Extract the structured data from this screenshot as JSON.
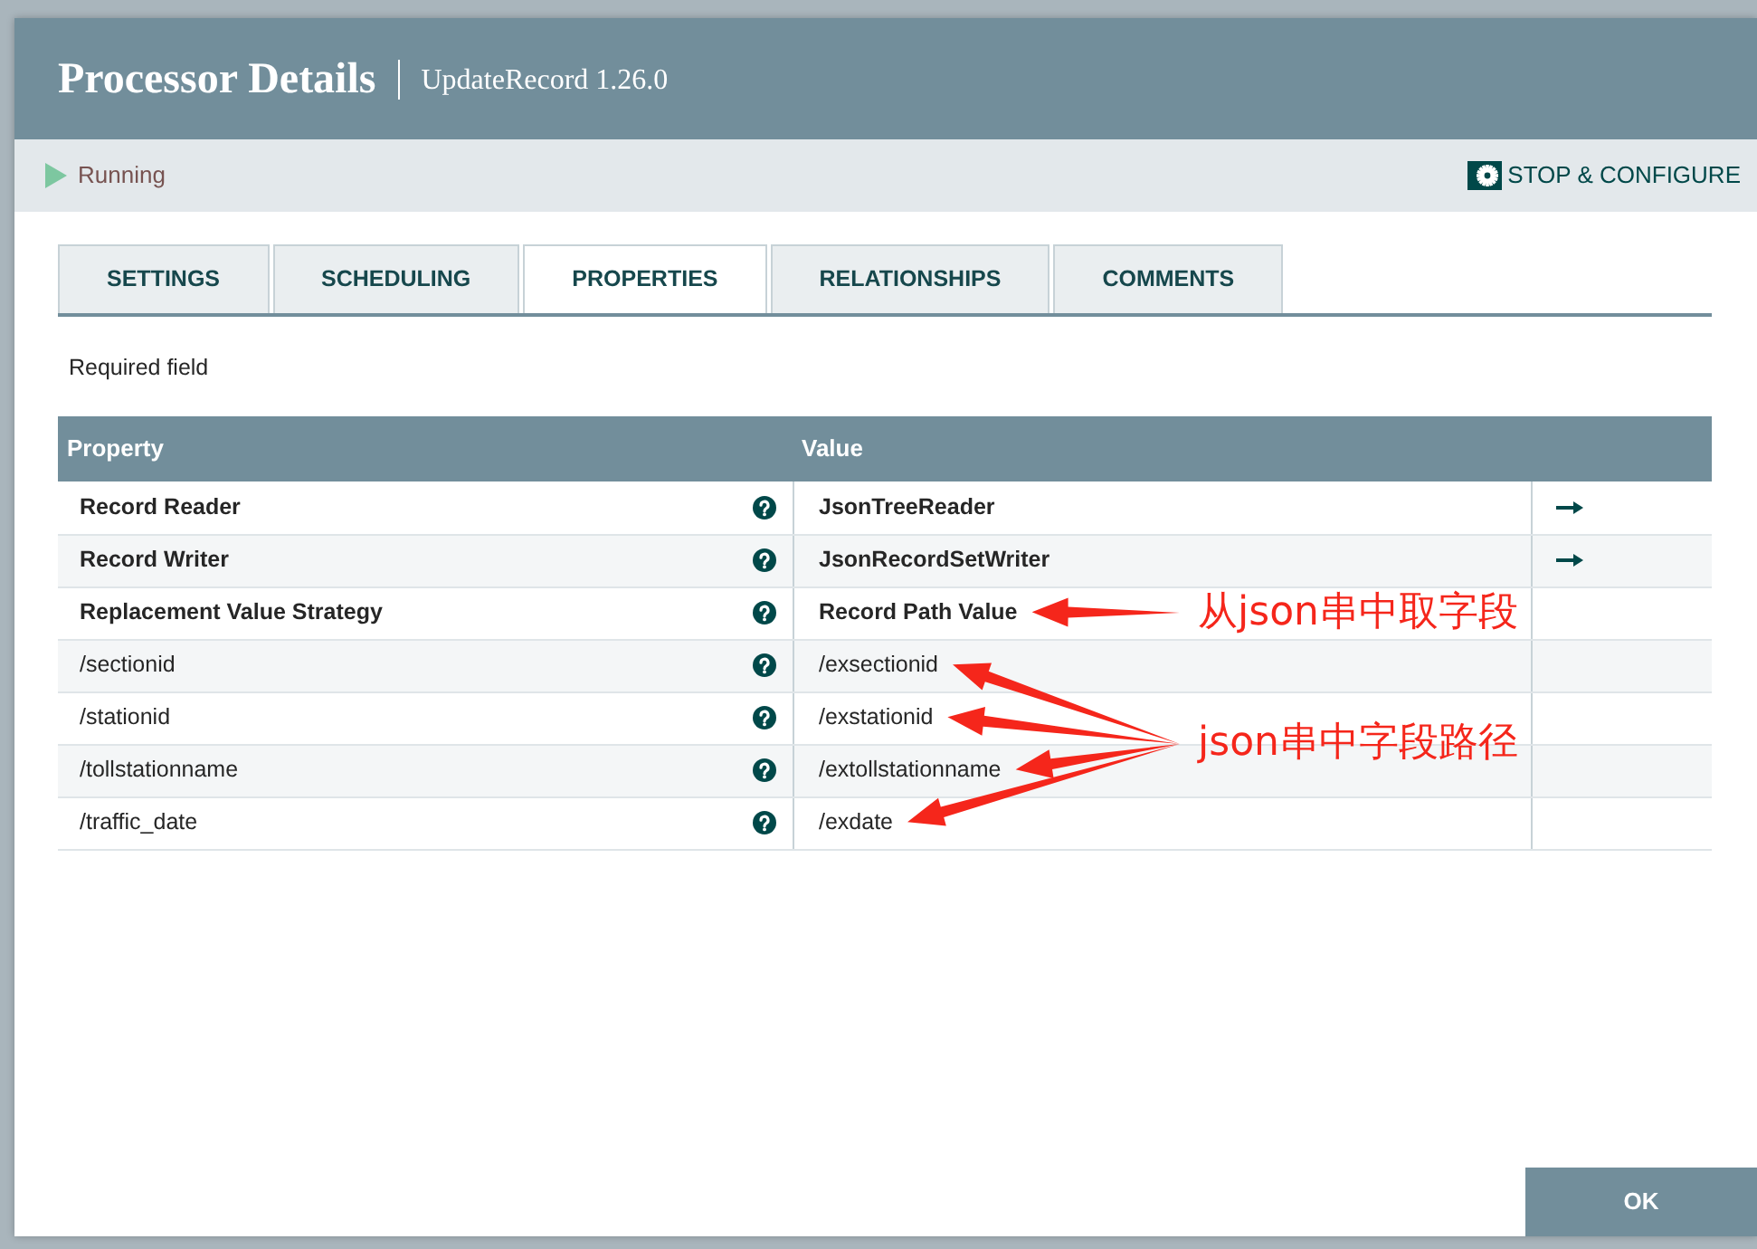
{
  "dialog": {
    "title": "Processor Details",
    "subtitle": "UpdateRecord 1.26.0"
  },
  "status": {
    "kind": "running",
    "label": "Running"
  },
  "toolbar": {
    "action": "STOP & CONFIGURE"
  },
  "tabs": [
    {
      "label": "SETTINGS",
      "selected": false
    },
    {
      "label": "SCHEDULING",
      "selected": false
    },
    {
      "label": "PROPERTIES",
      "selected": true
    },
    {
      "label": "RELATIONSHIPS",
      "selected": false
    },
    {
      "label": "COMMENTS",
      "selected": false
    }
  ],
  "required_note": "Required field",
  "table": {
    "columns": [
      "Property",
      "Value"
    ],
    "rows": [
      {
        "property": "Record Reader",
        "required": true,
        "value": "JsonTreeReader",
        "go_to": true,
        "arrow": false
      },
      {
        "property": "Record Writer",
        "required": true,
        "value": "JsonRecordSetWriter",
        "go_to": true,
        "arrow": false
      },
      {
        "property": "Replacement Value Strategy",
        "required": true,
        "value": "Record Path Value",
        "go_to": false,
        "arrow": true,
        "callout": "从json串中取字段"
      },
      {
        "property": "/sectionid",
        "required": false,
        "value": "/exsectionid",
        "go_to": false,
        "arrow": true,
        "callout": "json串中字段路径"
      },
      {
        "property": "/stationid",
        "required": false,
        "value": "/exstationid",
        "go_to": false,
        "arrow": true
      },
      {
        "property": "/tollstationname",
        "required": false,
        "value": "/extollstationname",
        "go_to": false,
        "arrow": true
      },
      {
        "property": "/traffic_date",
        "required": false,
        "value": "/exdate",
        "go_to": false,
        "arrow": true
      }
    ]
  },
  "buttons": [
    {
      "label": "OK"
    }
  ]
}
